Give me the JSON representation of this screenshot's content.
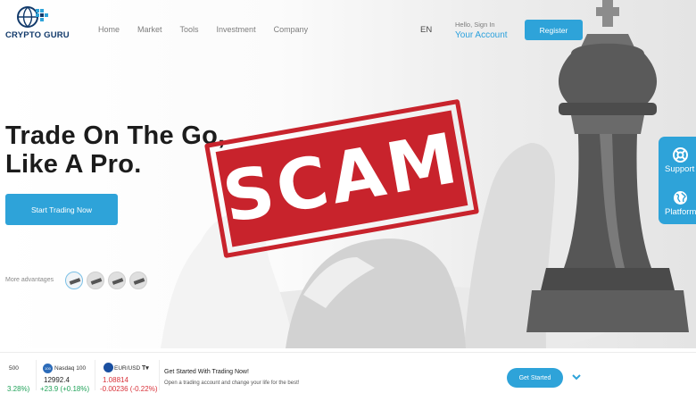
{
  "brand": {
    "name": "CRYPTO GURU",
    "logo_icon": "globe-network-icon"
  },
  "nav": {
    "items": [
      {
        "label": "Home"
      },
      {
        "label": "Market"
      },
      {
        "label": "Tools"
      },
      {
        "label": "Investment"
      },
      {
        "label": "Company"
      }
    ]
  },
  "header": {
    "language": "EN",
    "greeting": "Hello, Sign In",
    "account_link": "Your Account",
    "register_label": "Register"
  },
  "hero": {
    "headline_line1": "Trade On The Go,",
    "headline_line2": "Like A Pro.",
    "cta_label": "Start Trading Now",
    "advantages_label": "More advantages",
    "background_icon": "chess-king-icon"
  },
  "stamp": {
    "text": "SCAM",
    "color": "#c8232c"
  },
  "side_widget": {
    "items": [
      {
        "label": "Support",
        "icon": "lifebuoy-icon"
      },
      {
        "label": "Platform",
        "icon": "globe-icon"
      }
    ]
  },
  "ticker": {
    "items": [
      {
        "name": "500",
        "change": "3.28%)"
      },
      {
        "badge": "100",
        "name": "Nasdaq 100",
        "value": "12992.4",
        "change": "+23.9 (+0.18%)"
      },
      {
        "name": "EUR/USD",
        "value": "1.08814",
        "change": "-0.00236 (-0.22%)",
        "source_icon": "tradingview-icon"
      }
    ]
  },
  "getting_started": {
    "title": "Get Started With Trading Now!",
    "subtitle": "Open a trading account and change your life for the best!",
    "button_label": "Get Started"
  },
  "colors": {
    "accent": "#2ea3d9",
    "brand": "#123a6b",
    "up": "#21a35a",
    "down": "#d9323a"
  }
}
